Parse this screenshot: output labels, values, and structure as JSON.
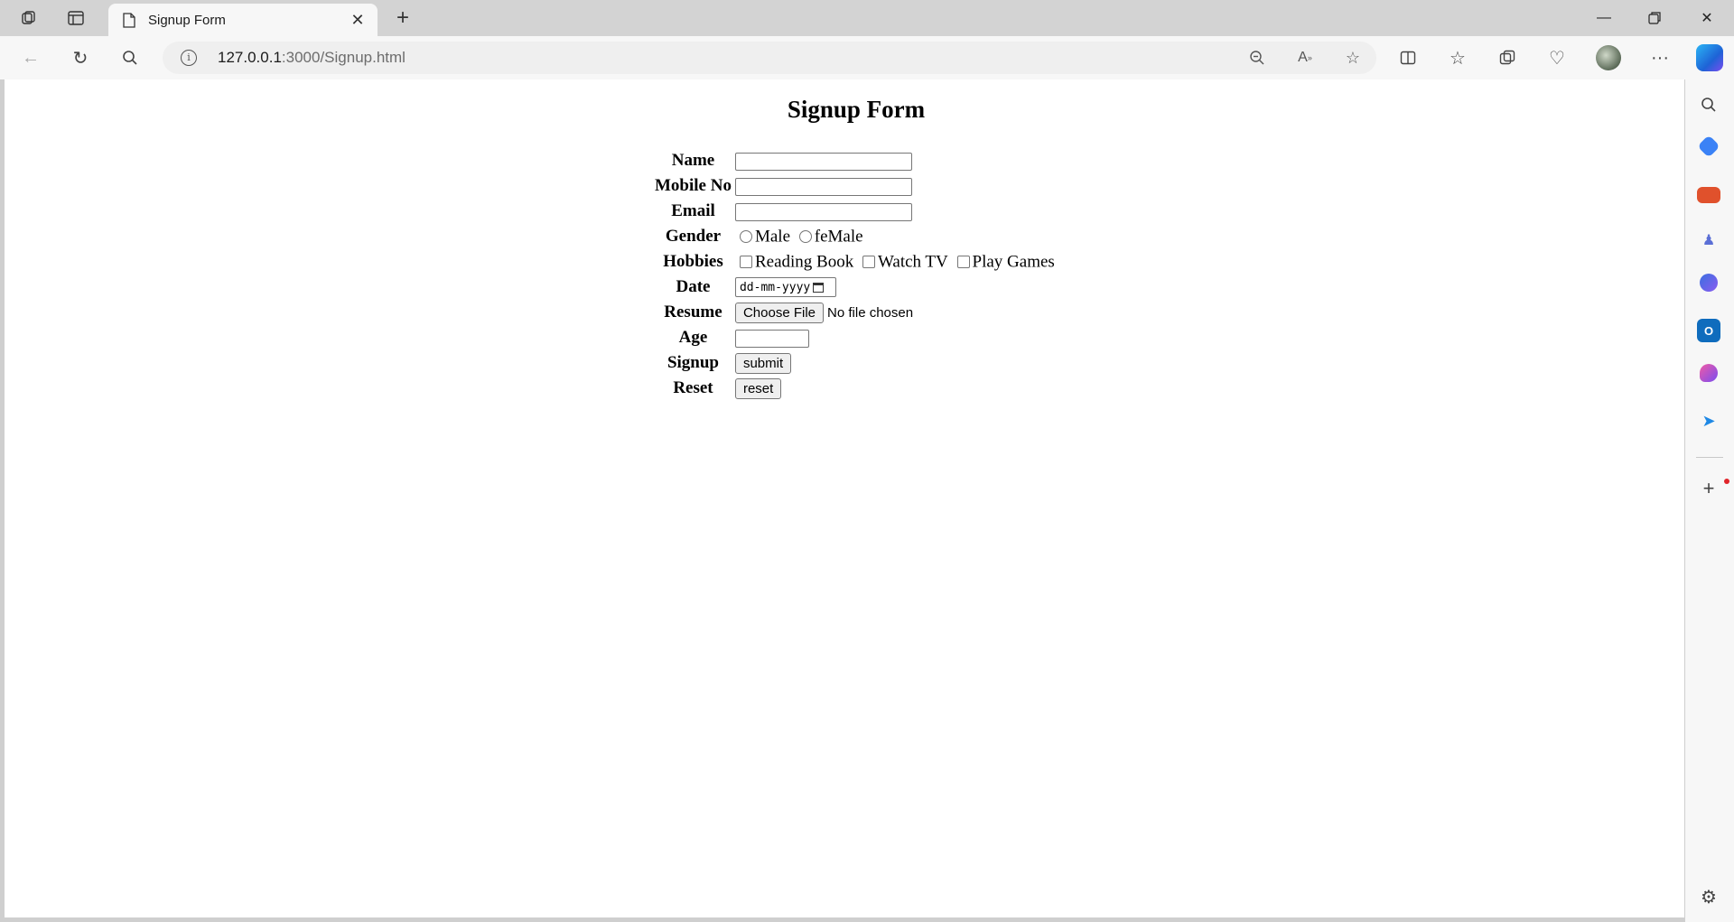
{
  "browser": {
    "tab": {
      "title": "Signup Form"
    },
    "address": {
      "host": "127.0.0.1",
      "rest": ":3000/Signup.html"
    }
  },
  "page": {
    "title": "Signup Form",
    "fields": {
      "name_label": "Name",
      "mobile_label": "Mobile No",
      "email_label": "Email",
      "gender_label": "Gender",
      "gender_options": [
        "Male",
        "feMale"
      ],
      "hobbies_label": "Hobbies",
      "hobby_options": [
        "Reading Book",
        "Watch TV",
        "Play Games"
      ],
      "date_label": "Date",
      "date_placeholder": "dd-mm-yyyy",
      "resume_label": "Resume",
      "file_button": "Choose File",
      "file_status": "No file chosen",
      "age_label": "Age",
      "signup_label": "Signup",
      "submit_button": "submit",
      "reset_label": "Reset",
      "reset_button": "reset"
    }
  },
  "colors": {
    "accent_dot": "#e0242a",
    "page_bg": "#ffffff",
    "chrome_bg": "#f7f7f7"
  }
}
